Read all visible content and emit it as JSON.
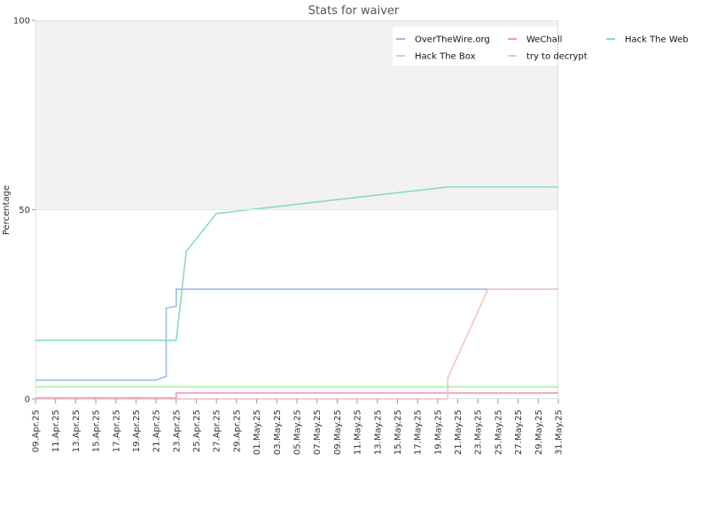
{
  "chart_data": {
    "type": "line",
    "title": "Stats for waiver",
    "ylabel": "Percentage",
    "xlabel": "",
    "ylim": [
      0,
      100
    ],
    "xlim": [
      "2025-04-09",
      "2025-05-31"
    ],
    "yticks": [
      0,
      50,
      100
    ],
    "yband_shaded": [
      50,
      100
    ],
    "xtick_labels": [
      "09.Apr.25",
      "11.Apr.25",
      "13.Apr.25",
      "15.Apr.25",
      "17.Apr.25",
      "19.Apr.25",
      "21.Apr.25",
      "23.Apr.25",
      "25.Apr.25",
      "27.Apr.25",
      "29.Apr.25",
      "01.May.25",
      "03.May.25",
      "05.May.25",
      "07.May.25",
      "09.May.25",
      "11.May.25",
      "13.May.25",
      "15.May.25",
      "17.May.25",
      "19.May.25",
      "21.May.25",
      "23.May.25",
      "25.May.25",
      "27.May.25",
      "29.May.25",
      "31.May.25"
    ],
    "xtick_dates": [
      "2025-04-09",
      "2025-04-11",
      "2025-04-13",
      "2025-04-15",
      "2025-04-17",
      "2025-04-19",
      "2025-04-21",
      "2025-04-23",
      "2025-04-25",
      "2025-04-27",
      "2025-04-29",
      "2025-05-01",
      "2025-05-03",
      "2025-05-05",
      "2025-05-07",
      "2025-05-09",
      "2025-05-11",
      "2025-05-13",
      "2025-05-15",
      "2025-05-17",
      "2025-05-19",
      "2025-05-21",
      "2025-05-23",
      "2025-05-25",
      "2025-05-27",
      "2025-05-29",
      "2025-05-31"
    ],
    "legend_position": "top-right",
    "grid": false,
    "series": [
      {
        "name": "OverTheWire.org",
        "color": "#99bbee",
        "points": [
          [
            "2025-04-09",
            5
          ],
          [
            "2025-04-21",
            5
          ],
          [
            "2025-04-22",
            6
          ],
          [
            "2025-04-22",
            24
          ],
          [
            "2025-04-23",
            24.5
          ],
          [
            "2025-04-23",
            29
          ],
          [
            "2025-05-31",
            29
          ]
        ]
      },
      {
        "name": "WeChall",
        "color": "#ee99bb",
        "points": [
          [
            "2025-04-09",
            0.3
          ],
          [
            "2025-04-23",
            0.3
          ],
          [
            "2025-04-23",
            1.6
          ],
          [
            "2025-05-31",
            1.6
          ]
        ]
      },
      {
        "name": "Hack The Web",
        "color": "#88ddbb",
        "points": [
          [
            "2025-04-09",
            15.5
          ],
          [
            "2025-04-23",
            15.5
          ],
          [
            "2025-04-24",
            39
          ],
          [
            "2025-04-27",
            49
          ],
          [
            "2025-05-20",
            56
          ],
          [
            "2025-05-31",
            56
          ]
        ]
      },
      {
        "name": "Hack The Box",
        "color": "#aaeeaa",
        "points": [
          [
            "2025-04-09",
            3.2
          ],
          [
            "2025-05-31",
            3.2
          ]
        ]
      },
      {
        "name": "try to decrypt",
        "color": "#f4c4c4",
        "points": [
          [
            "2025-04-09",
            0
          ],
          [
            "2025-05-20",
            0
          ],
          [
            "2025-05-20",
            5.5
          ],
          [
            "2025-05-24",
            29
          ],
          [
            "2025-05-31",
            29
          ]
        ]
      }
    ]
  }
}
